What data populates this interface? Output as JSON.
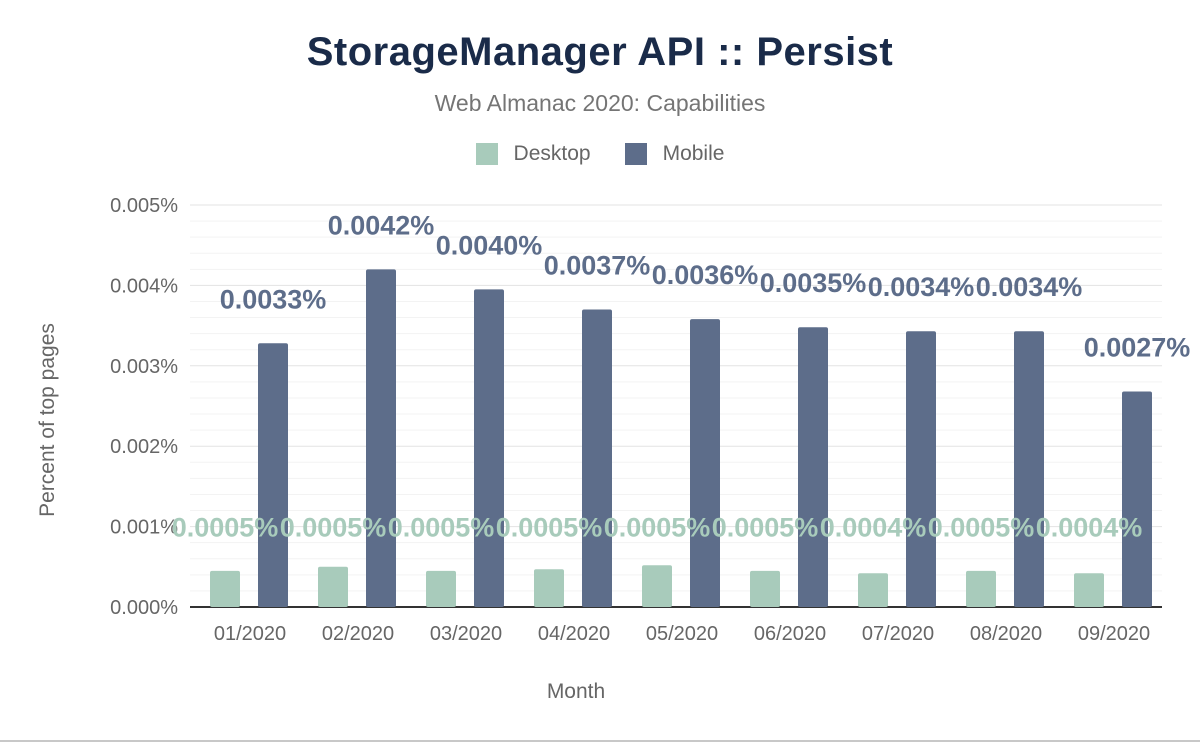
{
  "chart_data": {
    "type": "bar",
    "title": "StorageManager API :: Persist",
    "subtitle": "Web Almanac 2020: Capabilities",
    "xlabel": "Month",
    "ylabel": "Percent of top pages",
    "categories": [
      "01/2020",
      "02/2020",
      "03/2020",
      "04/2020",
      "05/2020",
      "06/2020",
      "07/2020",
      "08/2020",
      "09/2020"
    ],
    "ylim": [
      0,
      0.005
    ],
    "yticks": [
      "0.000%",
      "0.001%",
      "0.002%",
      "0.003%",
      "0.004%",
      "0.005%"
    ],
    "grid": true,
    "legend_position": "top",
    "series": [
      {
        "name": "Desktop",
        "color": "#a8cbbb",
        "values": [
          0.00045,
          0.0005,
          0.00045,
          0.00047,
          0.00052,
          0.00045,
          0.00042,
          0.00045,
          0.00042
        ],
        "labels": [
          "0.0005%",
          "0.0005%",
          "0.0005%",
          "0.0005%",
          "0.0005%",
          "0.0005%",
          "0.0004%",
          "0.0005%",
          "0.0004%"
        ]
      },
      {
        "name": "Mobile",
        "color": "#5d6d8a",
        "values": [
          0.00328,
          0.0042,
          0.00395,
          0.0037,
          0.00358,
          0.00348,
          0.00343,
          0.00343,
          0.00268
        ],
        "labels": [
          "0.0033%",
          "0.0042%",
          "0.0040%",
          "0.0037%",
          "0.0036%",
          "0.0035%",
          "0.0034%",
          "0.0034%",
          "0.0027%"
        ]
      }
    ]
  }
}
